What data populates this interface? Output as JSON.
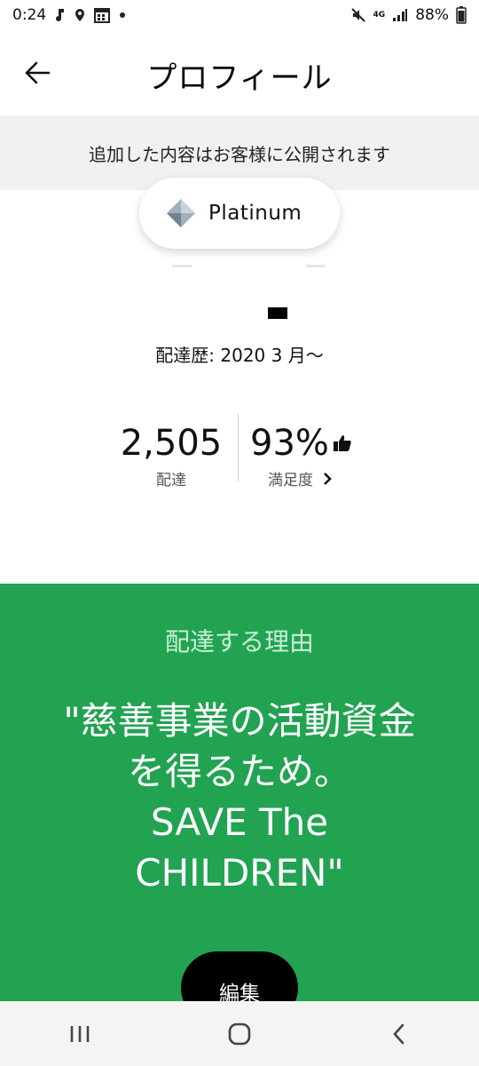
{
  "status_bar": {
    "time": "0:24",
    "network": "4G",
    "battery": "88%"
  },
  "app_bar": {
    "title": "プロフィール"
  },
  "notice": {
    "text": "追加した内容はお客様に公開されます"
  },
  "tier": {
    "label": "Platinum",
    "icon": "diamond-icon"
  },
  "profile": {
    "since": "配達歴: 2020 3 月～"
  },
  "stats": {
    "deliveries_value": "2,505",
    "deliveries_label": "配達",
    "satisfaction_value": "93%",
    "satisfaction_label": "満足度"
  },
  "reason": {
    "heading": "配達する理由",
    "line1": "\"慈善事業の活動資金",
    "line2": "を得るため。",
    "line3": "SAVE The",
    "line4": "CHILDREN\"",
    "edit_label": "編集"
  },
  "colors": {
    "green": "#21a352",
    "banner": "#f1f1f1"
  }
}
